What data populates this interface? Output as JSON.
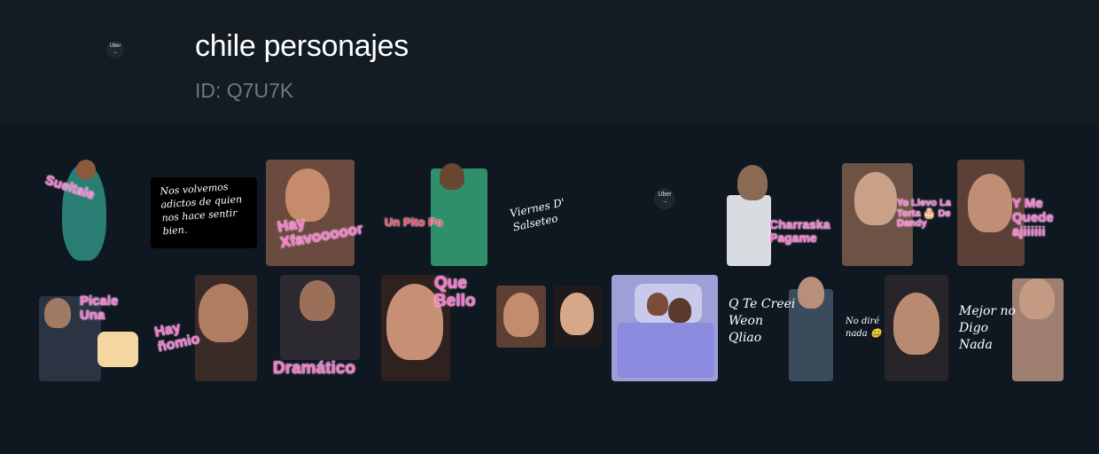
{
  "header": {
    "title": "chile personajes",
    "pack_id": "ID: Q7U7K",
    "icon_text": "Uber",
    "icon_arrow": "→"
  },
  "stickers": [
    {
      "caption": "Sueltale"
    },
    {
      "caption": "Nos volvemos adictos de quien nos hace sentir bien."
    },
    {
      "caption": "Hay Xfavooooor"
    },
    {
      "caption": "Un Pito Po"
    },
    {
      "caption": "Viernes D' Salseteo"
    },
    {
      "caption": "Uber"
    },
    {
      "caption": "Charraska Pagame"
    },
    {
      "caption": "Yo Llevo La Torta 🎂 De Dandy"
    },
    {
      "caption": "Y Me Quede ajiiiiii"
    },
    {
      "caption": "Picale Una"
    },
    {
      "caption": "Hay ñomio"
    },
    {
      "caption": "Dramático"
    },
    {
      "caption": "Que Bello"
    },
    {
      "caption": ""
    },
    {
      "caption": ""
    },
    {
      "caption": "Q Te Creei Weon Qliao"
    },
    {
      "caption": "No diré nada 🤐"
    },
    {
      "caption": "Mejor no Digo Nada"
    }
  ],
  "colors": {
    "background": "#0f1720",
    "header_bg": "#131b23",
    "caption_pink": "#ff6fd0",
    "id_gray": "#6f7780"
  }
}
